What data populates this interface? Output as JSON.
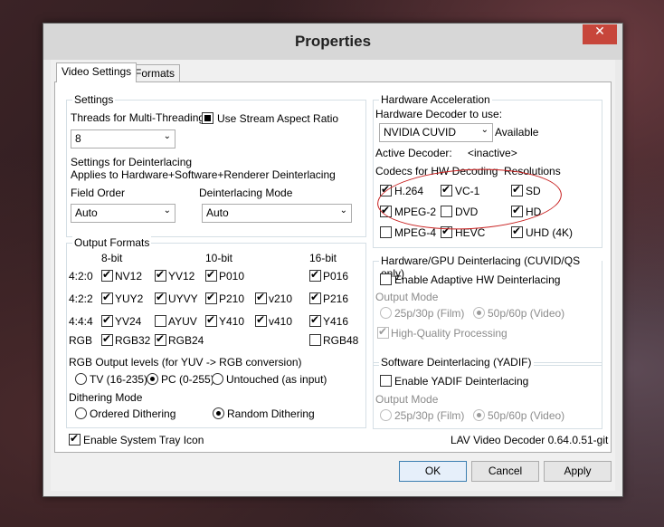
{
  "title": "Properties",
  "close_glyph": "✕",
  "tabs": [
    "Video Settings",
    "Formats"
  ],
  "settings": {
    "group": "Settings",
    "threads_label": "Threads for Multi-Threading",
    "threads_value": "8",
    "stream_aspect": "Use Stream Aspect Ratio",
    "deint_line1": "Settings for Deinterlacing",
    "deint_line2": "Applies to Hardware+Software+Renderer Deinterlacing",
    "field_order_label": "Field Order",
    "field_order_value": "Auto",
    "deint_mode_label": "Deinterlacing Mode",
    "deint_mode_value": "Auto"
  },
  "hwaccel": {
    "group": "Hardware Acceleration",
    "decoder_label": "Hardware Decoder to use:",
    "decoder_value": "NVIDIA CUVID",
    "available": "Available",
    "active_label": "Active Decoder:",
    "active_value": "<inactive>",
    "codecs_label": "Codecs for HW Decoding",
    "resolutions_label": "Resolutions",
    "codecs": [
      "H.264",
      "VC-1",
      "MPEG-2",
      "DVD",
      "MPEG-4",
      "HEVC"
    ],
    "resolutions": [
      "SD",
      "HD",
      "UHD (4K)"
    ]
  },
  "output": {
    "group": "Output Formats",
    "headers": [
      "8-bit",
      "10-bit",
      "16-bit"
    ],
    "rows": [
      "4:2:0",
      "4:2:2",
      "4:4:4",
      "RGB"
    ],
    "formats": [
      "NV12",
      "YV12",
      "P010",
      "P016",
      "YUY2",
      "UYVY",
      "P210",
      "v210",
      "P216",
      "YV24",
      "AYUV",
      "Y410",
      "v410",
      "Y416",
      "RGB32",
      "RGB24",
      "RGB48"
    ],
    "rgb_levels_label": "RGB Output levels (for YUV -> RGB conversion)",
    "levels": [
      "TV (16-235)",
      "PC (0-255)",
      "Untouched (as input)"
    ],
    "dither_label": "Dithering Mode",
    "dithers": [
      "Ordered Dithering",
      "Random Dithering"
    ]
  },
  "hwdeint": {
    "group": "Hardware/GPU Deinterlacing (CUVID/QS only)",
    "enable": "Enable Adaptive HW Deinterlacing",
    "output_mode": "Output Mode",
    "film": "25p/30p (Film)",
    "video": "50p/60p (Video)",
    "hq": "High-Quality Processing"
  },
  "swdeint": {
    "group": "Software Deinterlacing (YADIF)",
    "enable": "Enable YADIF Deinterlacing",
    "output_mode": "Output Mode",
    "film": "25p/30p (Film)",
    "video": "50p/60p (Video)"
  },
  "tray": "Enable System Tray Icon",
  "version": "LAV Video Decoder 0.64.0.51-git",
  "buttons": {
    "ok": "OK",
    "cancel": "Cancel",
    "apply": "Apply"
  },
  "colors": {
    "close": "#c7463b",
    "annotation": "#c82020"
  }
}
